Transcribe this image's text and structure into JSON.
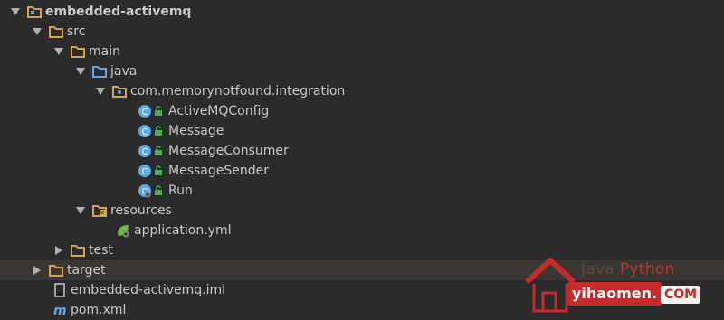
{
  "tree": {
    "root": "embedded-activemq",
    "src": "src",
    "main": "main",
    "java": "java",
    "package": "com.memorynotfound.integration",
    "classes": [
      "ActiveMQConfig",
      "Message",
      "MessageConsumer",
      "MessageSender",
      "Run"
    ],
    "resources": "resources",
    "app_yml": "application.yml",
    "test": "test",
    "target": "target",
    "iml": "embedded-activemq.iml",
    "pom": "pom.xml"
  },
  "watermark": {
    "java": "Java",
    "python": "Python",
    "site": "yihaomen.",
    "com": "COM"
  },
  "colors": {
    "background": "#2b2b2b",
    "selected_row": "#3a3634",
    "folder": "#d3a24e",
    "class_icon": "#5aa9e6",
    "lock": "#4caf50",
    "text": "#c9c9c9"
  }
}
